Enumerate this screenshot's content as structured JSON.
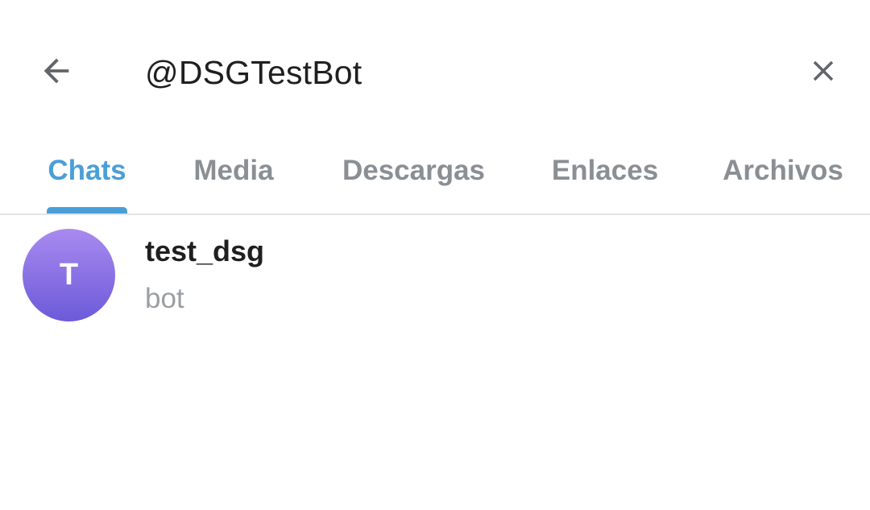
{
  "search": {
    "query": "@DSGTestBot",
    "back_icon": "arrow-left-icon",
    "close_icon": "close-icon"
  },
  "tabs": [
    {
      "label": "Chats",
      "active": true
    },
    {
      "label": "Media",
      "active": false
    },
    {
      "label": "Descargas",
      "active": false
    },
    {
      "label": "Enlaces",
      "active": false
    },
    {
      "label": "Archivos",
      "active": false
    }
  ],
  "results": [
    {
      "avatar_letter": "T",
      "name": "test_dsg",
      "subtitle": "bot"
    }
  ],
  "colors": {
    "accent": "#4a9fd8",
    "tab_inactive": "#8a8f94",
    "text_primary": "#1f1f1f",
    "text_secondary": "#9b9fa3",
    "avatar_top": "#a98af0",
    "avatar_bottom": "#6c5ad9"
  }
}
